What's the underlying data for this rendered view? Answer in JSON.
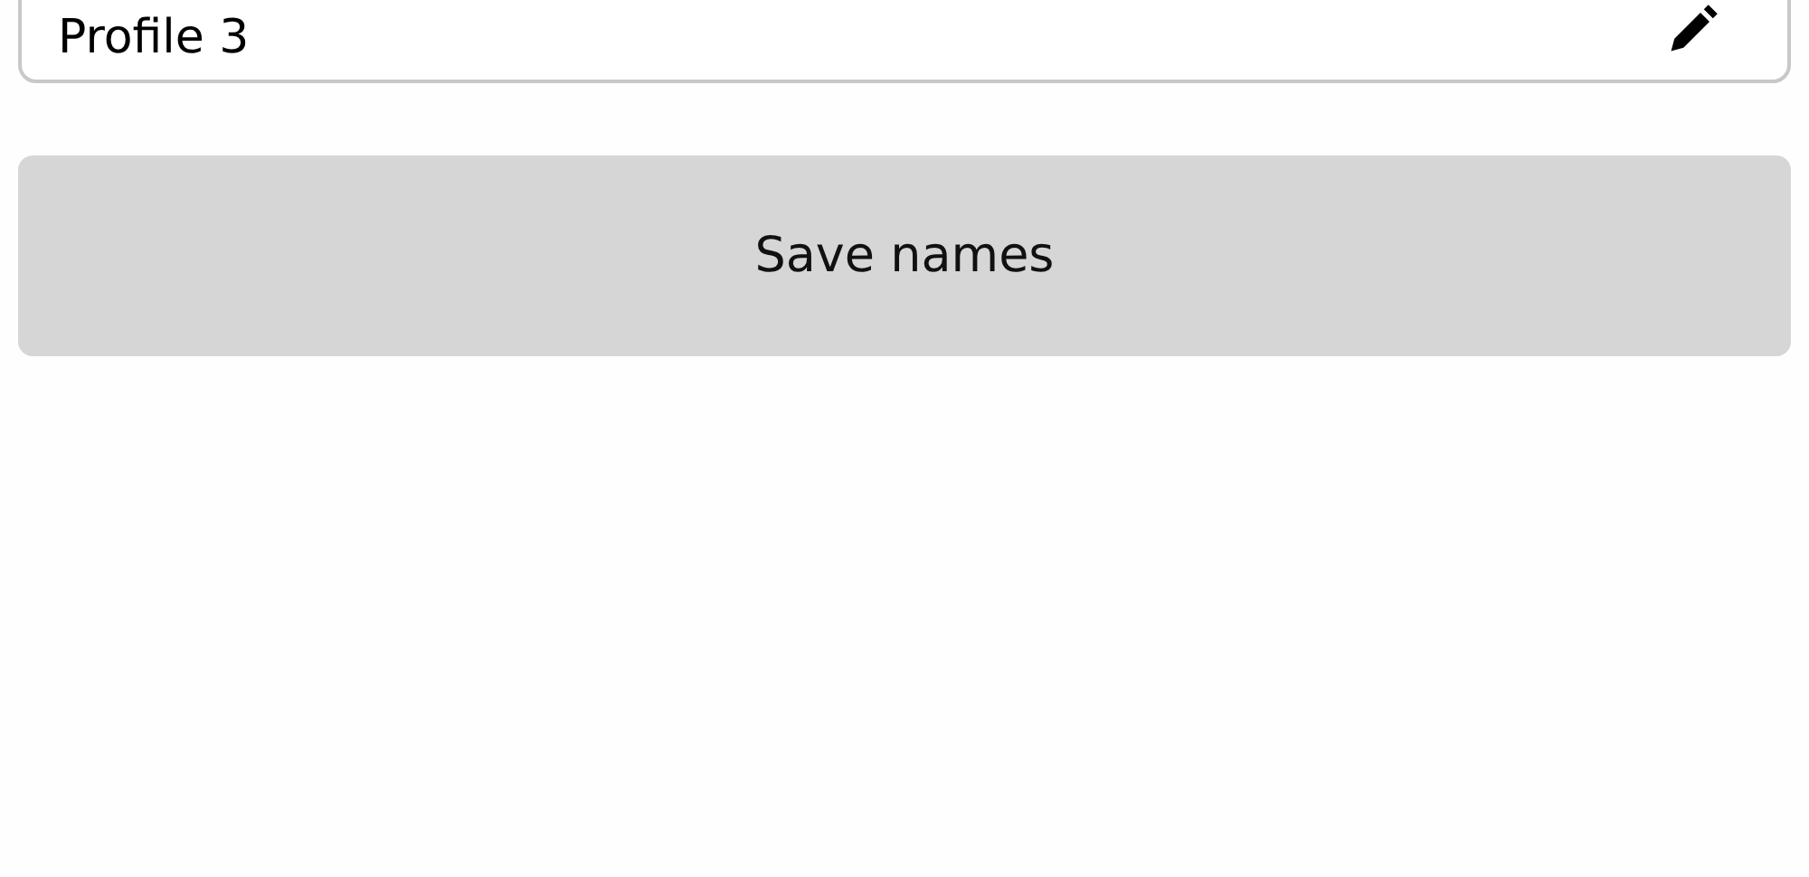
{
  "name_field": {
    "value": "Profile 3"
  },
  "save_button": {
    "label": "Save names"
  }
}
